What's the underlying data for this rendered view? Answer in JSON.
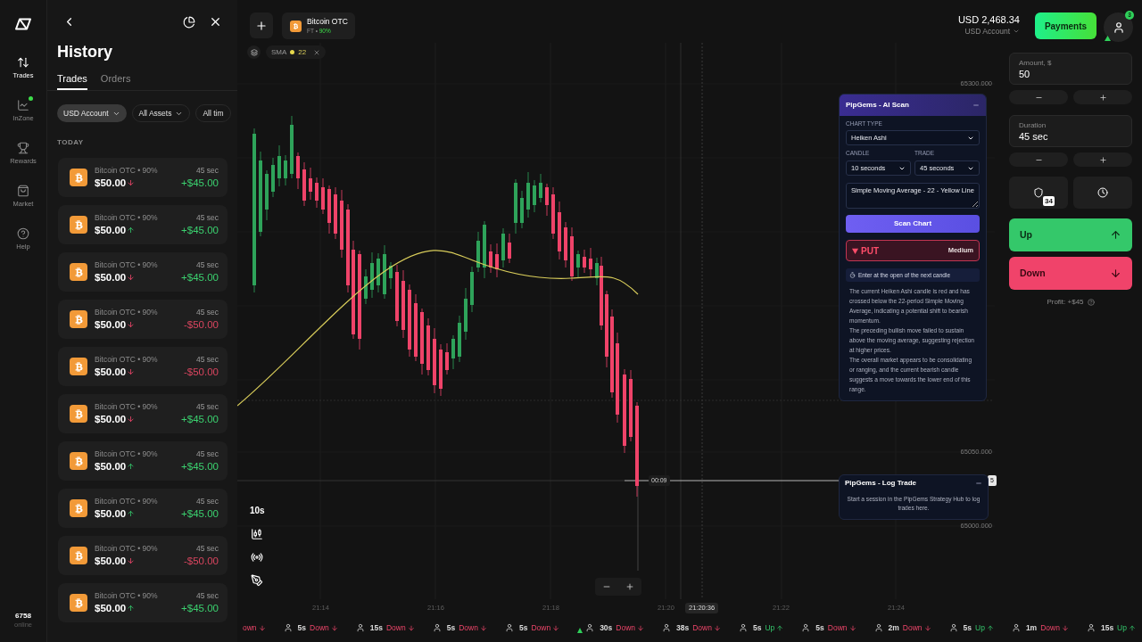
{
  "nav": {
    "items": [
      {
        "label": "Trades",
        "selected": true,
        "notification": false
      },
      {
        "label": "InZone",
        "selected": false,
        "notification": true
      },
      {
        "label": "Rewards",
        "selected": false,
        "notification": false
      },
      {
        "label": "Market",
        "selected": false,
        "notification": false
      },
      {
        "label": "Help",
        "selected": false,
        "notification": false
      }
    ],
    "online_count": "6758",
    "online_label": "online"
  },
  "history": {
    "title": "History",
    "tabs": [
      {
        "label": "Trades",
        "selected": true
      },
      {
        "label": "Orders",
        "selected": false
      }
    ],
    "filters": [
      {
        "label": "USD Account",
        "selected": true,
        "dropdown": true
      },
      {
        "label": "All Assets",
        "selected": false,
        "dropdown": true
      },
      {
        "label": "All tim",
        "selected": false,
        "dropdown": false
      }
    ],
    "group_label": "TODAY",
    "trades": [
      {
        "asset": "Bitcoin OTC • 90%",
        "amount": "$50.00",
        "up": false,
        "duration": "45 sec",
        "result": "+$45.00",
        "profit": true
      },
      {
        "asset": "Bitcoin OTC • 90%",
        "amount": "$50.00",
        "up": true,
        "duration": "45 sec",
        "result": "+$45.00",
        "profit": true
      },
      {
        "asset": "Bitcoin OTC • 90%",
        "amount": "$50.00",
        "up": false,
        "duration": "45 sec",
        "result": "+$45.00",
        "profit": true
      },
      {
        "asset": "Bitcoin OTC • 90%",
        "amount": "$50.00",
        "up": false,
        "duration": "45 sec",
        "result": "-$50.00",
        "profit": false
      },
      {
        "asset": "Bitcoin OTC • 90%",
        "amount": "$50.00",
        "up": false,
        "duration": "45 sec",
        "result": "-$50.00",
        "profit": false
      },
      {
        "asset": "Bitcoin OTC • 90%",
        "amount": "$50.00",
        "up": false,
        "duration": "45 sec",
        "result": "+$45.00",
        "profit": true
      },
      {
        "asset": "Bitcoin OTC • 90%",
        "amount": "$50.00",
        "up": true,
        "duration": "45 sec",
        "result": "+$45.00",
        "profit": true
      },
      {
        "asset": "Bitcoin OTC • 90%",
        "amount": "$50.00",
        "up": true,
        "duration": "45 sec",
        "result": "+$45.00",
        "profit": true
      },
      {
        "asset": "Bitcoin OTC • 90%",
        "amount": "$50.00",
        "up": false,
        "duration": "45 sec",
        "result": "-$50.00",
        "profit": false
      },
      {
        "asset": "Bitcoin OTC • 90%",
        "amount": "$50.00",
        "up": true,
        "duration": "45 sec",
        "result": "+$45.00",
        "profit": true
      }
    ]
  },
  "chart_header": {
    "asset_name": "Bitcoin OTC",
    "asset_meta": "FT •",
    "payout": "90%"
  },
  "indicator": {
    "name": "SMA",
    "value": "22",
    "color": "#e6d84c"
  },
  "account": {
    "balance": "USD 2,468.34",
    "account_name": "USD Account",
    "payments_button": "Payments",
    "notifications": "3"
  },
  "chart": {
    "timeframe": "10s",
    "price_labels": [
      "65300.000",
      "65050.000",
      "65000.000"
    ],
    "time_labels": [
      "21:14",
      "21:16",
      "21:18",
      "21:20",
      "21:22",
      "21:24"
    ],
    "crosshair_time": "21:20:36",
    "countdown": "00:09",
    "price_tag": "5"
  },
  "ai_scan": {
    "title": "PipGems - AI Scan",
    "chart_type_label": "CHART TYPE",
    "chart_type": "Heiken Ashi",
    "candle_label": "CANDLE",
    "candle": "10 seconds",
    "trade_label": "TRADE",
    "trade": "45 seconds",
    "indicator_note": "Simple Moving Average - 22 - Yellow Line",
    "scan_button": "Scan Chart",
    "signal": {
      "bearish": true,
      "label": "PUT",
      "strength": "Medium"
    },
    "entry_hint": "Enter at the open of the next candle",
    "analysis": [
      "The current Heiken Ashi candle is red and has crossed below the 22-period Simple Moving Average, indicating a potential shift to bearish momentum.",
      "The preceding bullish move failed to sustain above the moving average, suggesting rejection at higher prices.",
      "The overall market appears to be consolidating or ranging, and the current bearish candle suggests a move towards the lower end of this range."
    ]
  },
  "log_trade": {
    "title": "PipGems - Log Trade",
    "message": "Start a session in the PipGems Strategy Hub to log trades here."
  },
  "trade_panel": {
    "amount": {
      "label": "Amount, $",
      "value": "50"
    },
    "duration": {
      "label": "Duration",
      "value": "45 sec"
    },
    "risk_badge": "34",
    "actions": [
      {
        "label": "Up",
        "kind": "up"
      },
      {
        "label": "Down",
        "kind": "down"
      }
    ],
    "profit": "Profit: +$45"
  },
  "ticker": [
    {
      "label": "own",
      "up": false,
      "flagged": false
    },
    {
      "duration": "5s",
      "label": "Down",
      "up": false,
      "flagged": false
    },
    {
      "duration": "15s",
      "label": "Down",
      "up": false,
      "flagged": false
    },
    {
      "duration": "5s",
      "label": "Down",
      "up": false,
      "flagged": false
    },
    {
      "duration": "5s",
      "label": "Down",
      "up": false,
      "flagged": false
    },
    {
      "duration": "30s",
      "label": "Down",
      "up": false,
      "flagged": true
    },
    {
      "duration": "38s",
      "label": "Down",
      "up": false,
      "flagged": false
    },
    {
      "duration": "5s",
      "label": "Up",
      "up": true,
      "flagged": false
    },
    {
      "duration": "5s",
      "label": "Down",
      "up": false,
      "flagged": false
    },
    {
      "duration": "2m",
      "label": "Down",
      "up": false,
      "flagged": false
    },
    {
      "duration": "5s",
      "label": "Up",
      "up": true,
      "flagged": false
    },
    {
      "duration": "1m",
      "label": "Down",
      "up": false,
      "flagged": false
    },
    {
      "duration": "15s",
      "label": "Up",
      "up": true,
      "flagged": false
    }
  ]
}
